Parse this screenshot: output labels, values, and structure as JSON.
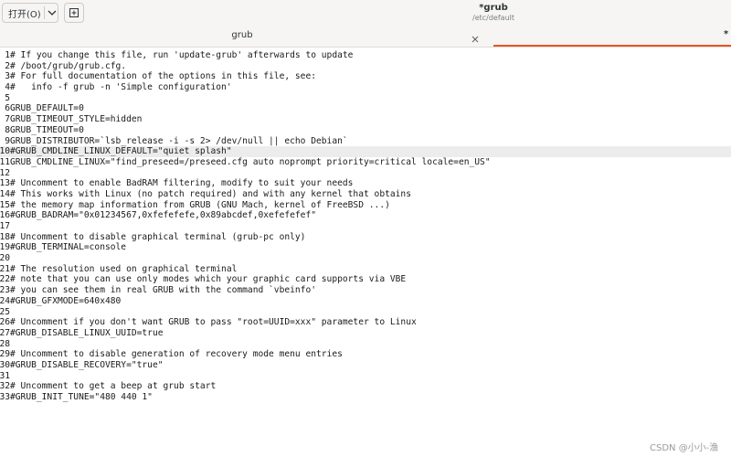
{
  "header": {
    "open_label": "打开(O)",
    "title": "*grub",
    "subtitle": "/etc/default"
  },
  "tabs": [
    {
      "label": "grub"
    }
  ],
  "tab_overflow": "*",
  "colors": {
    "accent": "#e95420",
    "current_line": "#ececec"
  },
  "icons": {
    "open_dropdown": "chevron-down-icon",
    "new_document": "new-document-icon",
    "tab_close": "close-icon"
  },
  "editor": {
    "current_line": 10,
    "lines": [
      {
        "n": "1",
        "text": "# If you change this file, run 'update-grub' afterwards to update"
      },
      {
        "n": "2",
        "text": "# /boot/grub/grub.cfg."
      },
      {
        "n": "3",
        "text": "# For full documentation of the options in this file, see:"
      },
      {
        "n": "4",
        "text": "#   info -f grub -n 'Simple configuration'"
      },
      {
        "n": "5",
        "text": ""
      },
      {
        "n": "6",
        "text": "GRUB_DEFAULT=0"
      },
      {
        "n": "7",
        "text": "GRUB_TIMEOUT_STYLE=hidden"
      },
      {
        "n": "8",
        "text": "GRUB_TIMEOUT=0"
      },
      {
        "n": "9",
        "text": "GRUB_DISTRIBUTOR=`lsb_release -i -s 2> /dev/null || echo Debian`"
      },
      {
        "n": "10",
        "text": "#GRUB_CMDLINE_LINUX_DEFAULT=\"quiet splash\""
      },
      {
        "n": "11",
        "text": "GRUB_CMDLINE_LINUX=\"find_preseed=/preseed.cfg auto noprompt priority=critical locale=en_US\""
      },
      {
        "n": "12",
        "text": ""
      },
      {
        "n": "13",
        "text": "# Uncomment to enable BadRAM filtering, modify to suit your needs"
      },
      {
        "n": "14",
        "text": "# This works with Linux (no patch required) and with any kernel that obtains"
      },
      {
        "n": "15",
        "text": "# the memory map information from GRUB (GNU Mach, kernel of FreeBSD ...)"
      },
      {
        "n": "16",
        "text": "#GRUB_BADRAM=\"0x01234567,0xfefefefe,0x89abcdef,0xefefefef\""
      },
      {
        "n": "17",
        "text": ""
      },
      {
        "n": "18",
        "text": "# Uncomment to disable graphical terminal (grub-pc only)"
      },
      {
        "n": "19",
        "text": "#GRUB_TERMINAL=console"
      },
      {
        "n": "20",
        "text": ""
      },
      {
        "n": "21",
        "text": "# The resolution used on graphical terminal"
      },
      {
        "n": "22",
        "text": "# note that you can use only modes which your graphic card supports via VBE"
      },
      {
        "n": "23",
        "text": "# you can see them in real GRUB with the command `vbeinfo'"
      },
      {
        "n": "24",
        "text": "#GRUB_GFXMODE=640x480"
      },
      {
        "n": "25",
        "text": ""
      },
      {
        "n": "26",
        "text": "# Uncomment if you don't want GRUB to pass \"root=UUID=xxx\" parameter to Linux"
      },
      {
        "n": "27",
        "text": "#GRUB_DISABLE_LINUX_UUID=true"
      },
      {
        "n": "28",
        "text": ""
      },
      {
        "n": "29",
        "text": "# Uncomment to disable generation of recovery mode menu entries"
      },
      {
        "n": "30",
        "text": "#GRUB_DISABLE_RECOVERY=\"true\""
      },
      {
        "n": "31",
        "text": ""
      },
      {
        "n": "32",
        "text": "# Uncomment to get a beep at grub start"
      },
      {
        "n": "33",
        "text": "#GRUB_INIT_TUNE=\"480 440 1\""
      }
    ]
  },
  "watermark": "CSDN @小小-渔"
}
